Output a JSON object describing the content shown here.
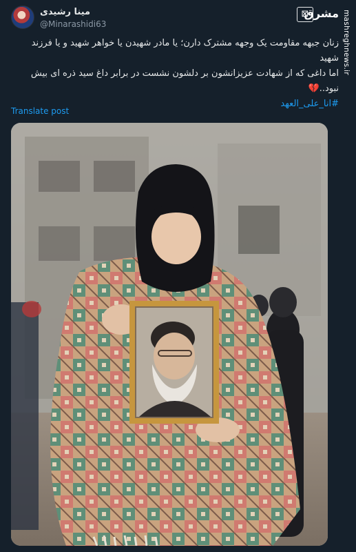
{
  "tweet": {
    "display_name": "مینا رشیدی",
    "handle": "@Minarashidi63",
    "lines": [
      "زنان جبهه مقاومت یک وجهه مشترک دارن؛ یا مادر شهیدن یا خواهر شهید و یا فرزند شهید",
      "اما داغی که از شهادت عزیزانشون بر دلشون نشست در برابر داغ سید ذره ای بیش نبود..",
      "#انا_علی_العهد"
    ],
    "emoji": "💔",
    "translate_label": "Translate post"
  },
  "watermark": {
    "logo": "⊠",
    "brand": "مشرق",
    "url": "mashreghnews.ir"
  },
  "media": {
    "alt_icon": "photo-icon"
  },
  "colors": {
    "background": "#15202b",
    "text": "#e7e9ea",
    "muted": "#8b98a5",
    "link": "#1d9bf0"
  }
}
